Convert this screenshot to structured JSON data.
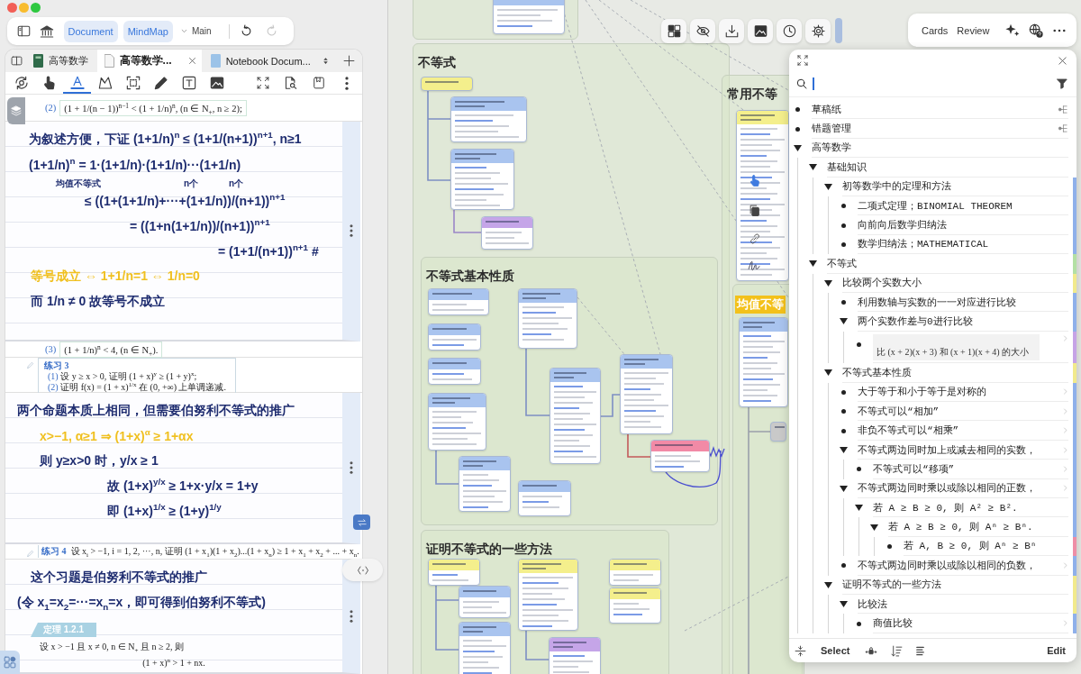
{
  "toolbar": {
    "views": [
      {
        "label": "Document",
        "selected": true
      },
      {
        "label": "MindMap",
        "selected": true
      }
    ],
    "branch": "Main",
    "history": [
      {
        "disabled": false
      },
      {
        "disabled": true
      }
    ]
  },
  "document": {
    "tabs": [
      {
        "label": "高等数学",
        "kind": "notebook",
        "selected": false
      },
      {
        "label": "高等数学...",
        "kind": "document",
        "selected": true
      },
      {
        "label": "Notebook Docum...",
        "kind": "page",
        "selected": false
      }
    ],
    "tools": [
      {
        "selected": false
      },
      {
        "selected": false
      },
      {
        "selected": true
      },
      {
        "selected": false
      },
      {
        "selected": false
      },
      {
        "selected": false
      },
      {
        "selected": false
      },
      {
        "selected": false
      }
    ],
    "sections": [
      {
        "kind": "formula",
        "items": [
          {
            "number": "(2)",
            "text": "(1 + 1/(n − 1))$^{n−1}$ < (1 + 1/n)$^{n}$, (n ∈ N$_{+}$, n ≥ 2);"
          }
        ]
      },
      {
        "kind": "ink",
        "lines": [
          {
            "text": "为叙述方便，下证 (1+1/n)$^{n}$ ≤ (1+1/(n+1))$^{n+1}$, n≥1",
            "color": "#1f2d70"
          },
          {
            "text": "(1+1/n)$^{n}$ = 1·(1+1/n)·(1+1/n)···(1+1/n)",
            "color": "#1f2d70"
          },
          {
            "notes": [
              "均值不等式",
              "n个",
              "n个"
            ],
            "text": "≤ ((1+(1+1/n)+···+(1+1/n))/(n+1))$^{n+1}$",
            "color": "#1f2d70"
          },
          {
            "text": "= ((1+n(1+1/n))/(n+1))$^{n+1}$",
            "color": "#1f2d70"
          },
          {
            "text": "= (1+1/(n+1))$^{n+1}$ #",
            "color": "#1f2d70"
          },
          {
            "text": "等号成立 ⇔ 1+1/n=1 ⇔ 1/n=0",
            "color": "#f0c020"
          },
          {
            "text": "而 1/n ≠ 0  故等号不成立",
            "color": "#1f2d70"
          }
        ]
      },
      {
        "kind": "formula",
        "items": [
          {
            "number": "(3)",
            "text": "(1 + 1/n)$^{n}$ < 4, (n ∈ N$_{+}$)."
          }
        ]
      },
      {
        "kind": "exercise",
        "title": "练习 3",
        "items": [
          {
            "number": "(1)",
            "text": "设 y ≥ x > 0, 证明 (1 + x)$^{y}$ ≥ (1 + y)$^{x}$;"
          },
          {
            "number": "(2)",
            "text": "证明 f(x) = (1 + x)$^{1/x}$ 在 (0, +∞) 上单调递减."
          }
        ]
      },
      {
        "kind": "ink",
        "lines": [
          {
            "text": "两个命题本质上相同，但需要伯努利不等式的推广",
            "color": "#1f2d70"
          },
          {
            "text": "x>−1, α≥1 ⇒ (1+x)$^{α}$ ≥ 1+αx",
            "color": "#f0c020"
          },
          {
            "text": "则 y≥x>0 时，y/x ≥ 1",
            "color": "#1f2d70"
          },
          {
            "text": "故 (1+x)$^{y/x}$ ≥ 1+x·y/x = 1+y",
            "color": "#1f2d70"
          },
          {
            "text": "即 (1+x)$^{1/x}$ ≥ (1+y)$^{1/y}$",
            "color": "#1f2d70"
          }
        ]
      },
      {
        "kind": "exercise_line",
        "title": "练习 4",
        "text": "设 x$_{i}$ > −1, i = 1, 2, ···, n, 证明 (1 + x$_{1}$)(1 + x$_{2}$)...(1 + x$_{n}$) ≥ 1 + x$_{1}$ + x$_{2}$ + ... + x$_{n}$."
      },
      {
        "kind": "ink",
        "lines": [
          {
            "text": "这个习题是伯努利不等式的推广",
            "color": "#1f2d70"
          },
          {
            "text": "(令 x$_{1}$=x$_{2}$=···=x$_{n}$=x，即可得到伯努利不等式)",
            "color": "#1f2d70"
          }
        ],
        "theorem": {
          "tag": "定理 1.2.1",
          "text": "设 x > −1 且 x ≠ 0, n ∈ N$_{+}$ 且 n ≥ 2, 则",
          "formula": "(1 + x)$^{n}$ > 1 + nx."
        }
      }
    ]
  },
  "canvas": {
    "groups": [
      {
        "title": "不等式",
        "highlight": false
      },
      {
        "title": "不等式基本性质",
        "highlight": false
      },
      {
        "title": "证明不等式的一些方法",
        "highlight": false
      },
      {
        "title": "常用不等",
        "highlight": false
      },
      {
        "title": "均值不等",
        "highlight": true
      }
    ],
    "cards": [
      {
        "color": "#a9c4ef"
      },
      {
        "color": "#f4ef8c"
      },
      {
        "color": "#a9c4ef"
      },
      {
        "color": "#a9c4ef"
      },
      {
        "color": "#c5a5e8"
      },
      {
        "color": "#a9c4ef"
      },
      {
        "color": "#a9c4ef"
      },
      {
        "color": "#a9c4ef"
      },
      {
        "color": "#a9c4ef"
      },
      {
        "color": "#a9c4ef"
      },
      {
        "color": "#a9c4ef"
      },
      {
        "color": "#a9c4ef"
      },
      {
        "color": "#a9c4ef"
      },
      {
        "color": "#f28aa6"
      },
      {
        "color": "#a9c4ef"
      },
      {
        "color": "#f4ef8c"
      },
      {
        "color": "#a9c4ef"
      },
      {
        "color": "#a9c4ef"
      },
      {
        "color": "#f4ef8c"
      },
      {
        "color": "#c5a5e8"
      },
      {
        "color": "#f4ef8c"
      },
      {
        "color": "#f4ef8c"
      },
      {
        "color": "#f4ef8c"
      },
      {
        "color": "#a9c4ef"
      },
      {
        "color": "#c9c9c9"
      }
    ]
  },
  "canvas_menu": [
    "Cards",
    "Review"
  ],
  "outline": {
    "items": [
      {
        "label": "草稿纸",
        "mindmap": true,
        "more": false
      },
      {
        "label": "错题管理",
        "mindmap": true,
        "more": false
      },
      {
        "label": "高等数学",
        "mindmap": false,
        "more": false,
        "expanded": true,
        "children": [
          {
            "label": "基础知识",
            "more": false,
            "expanded": true,
            "children": [
              {
                "label": "初等数学中的定理和方法",
                "more": false,
                "color": "#8fb0ea",
                "expanded": true,
                "children": [
                  {
                    "label": "二项式定理；BINOMIAL THEOREM",
                    "more": false,
                    "color": "#8fb0ea"
                  },
                  {
                    "label": "向前向后数学归纳法",
                    "more": false,
                    "color": "#8fb0ea"
                  },
                  {
                    "label": "数学归纳法；MATHEMATICAL",
                    "more": false,
                    "color": "#8fb0ea"
                  }
                ]
              }
            ]
          },
          {
            "label": "不等式",
            "more": false,
            "color": "#b3e0a4",
            "expanded": true,
            "children": [
              {
                "label": "比较两个实数大小",
                "more": false,
                "color": "#f1ea8c",
                "expanded": true,
                "children": [
                  {
                    "label": "利用数轴与实数的一一对应进行比较",
                    "more": false,
                    "color": "#8fb0ea"
                  },
                  {
                    "label": "两个实数作差与0进行比较",
                    "more": false,
                    "color": "#8fb0ea",
                    "expanded": true,
                    "children": [
                      {
                        "kind": "image",
                        "label": "比 (x + 2)(x + 3) 和 (x + 1)(x + 4) 的大小",
                        "more": true,
                        "color": "#c6a3e6"
                      }
                    ]
                  }
                ]
              },
              {
                "label": "不等式基本性质",
                "more": false,
                "color": "#f1ea8c",
                "expanded": true,
                "children": [
                  {
                    "label": "大于等于和小于等于是对称的",
                    "more": true,
                    "color": "#8fb0ea"
                  },
                  {
                    "label": "不等式可以“相加”",
                    "more": true,
                    "color": "#8fb0ea"
                  },
                  {
                    "label": "非负不等式可以“相乘”",
                    "more": true,
                    "color": "#8fb0ea"
                  },
                  {
                    "label": "不等式两边同时加上或减去相同的实数，",
                    "more": true,
                    "color": "#8fb0ea",
                    "expanded": true,
                    "children": [
                      {
                        "label": "不等式可以“移项”",
                        "more": true,
                        "color": "#8fb0ea"
                      }
                    ]
                  },
                  {
                    "label": "不等式两边同时乘以或除以相同的正数，",
                    "more": true,
                    "color": "#8fb0ea",
                    "expanded": true,
                    "children": [
                      {
                        "label": "若 A ≥ B ≥ 0, 则 A² ≥ B².",
                        "more": false,
                        "color": "#8fb0ea",
                        "expanded": true,
                        "children": [
                          {
                            "label": "若 A ≥ B ≥ 0, 则 Aⁿ ≥ Bⁿ.",
                            "more": false,
                            "color": "#8fb0ea",
                            "expanded": true,
                            "children": [
                              {
                                "label": "若 A, B ≥ 0, 则 Aⁿ ≥ Bⁿ",
                                "more": false,
                                "color": "#ee8ea6"
                              }
                            ]
                          }
                        ]
                      }
                    ]
                  },
                  {
                    "label": "不等式两边同时乘以或除以相同的负数，",
                    "more": true,
                    "color": "#8fb0ea"
                  }
                ]
              },
              {
                "label": "证明不等式的一些方法",
                "more": false,
                "color": "#f1ea8c",
                "expanded": true,
                "children": [
                  {
                    "label": "比较法",
                    "more": false,
                    "color": "#f1ea8c",
                    "expanded": true,
                    "children": [
                      {
                        "label": "商值比较",
                        "more": true,
                        "color": "#8fb0ea"
                      }
                    ]
                  }
                ]
              }
            ]
          }
        ]
      }
    ],
    "footer": [
      "Select",
      "Edit"
    ]
  }
}
